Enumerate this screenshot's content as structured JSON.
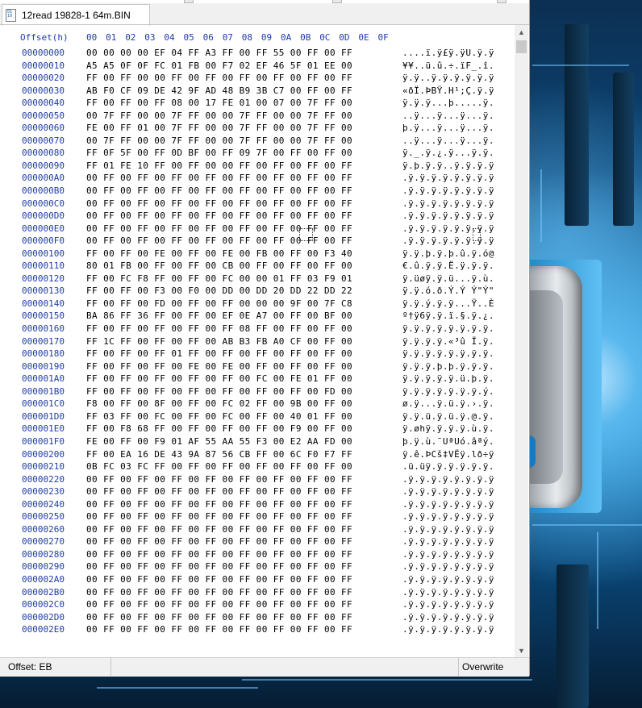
{
  "tab": {
    "title": "12read 19828-1 64m.BIN"
  },
  "header": {
    "offset_label": "Offset(h)",
    "columns": [
      "00",
      "01",
      "02",
      "03",
      "04",
      "05",
      "06",
      "07",
      "08",
      "09",
      "0A",
      "0B",
      "0C",
      "0D",
      "0E",
      "0F"
    ]
  },
  "rows": [
    {
      "offset": "00000000",
      "hex": "00 00 00 00 EF 04 FF A3 FF 00 FF 55 00 FF 00 FF",
      "ascii": "....ï.ÿ£ÿ.ÿU.ÿ.ÿ"
    },
    {
      "offset": "00000010",
      "hex": "A5 A5 0F 0F FC 01 FB 00 F7 02 EF 46 5F 01 EE 00",
      "ascii": "¥¥..ü.û.÷.ïF_.î."
    },
    {
      "offset": "00000020",
      "hex": "FF 00 FF 00 00 FF 00 FF 00 FF 00 FF 00 FF 00 FF",
      "ascii": "ÿ.ÿ..ÿ.ÿ.ÿ.ÿ.ÿ.ÿ"
    },
    {
      "offset": "00000030",
      "hex": "AB F0 CF 09 DE 42 9F AD 48 B9 3B C7 00 FF 00 FF",
      "ascii": "«ðÏ.ÞBŸ.H¹;Ç.ÿ.ÿ"
    },
    {
      "offset": "00000040",
      "hex": "FF 00 FF 00 FF 08 00 17 FE 01 00 07 00 7F FF 00",
      "ascii": "ÿ.ÿ.ÿ...þ.....ÿ."
    },
    {
      "offset": "00000050",
      "hex": "00 7F FF 00 00 7F FF 00 00 7F FF 00 00 7F FF 00",
      "ascii": "..ÿ...ÿ...ÿ...ÿ."
    },
    {
      "offset": "00000060",
      "hex": "FE 00 FF 01 00 7F FF 00 00 7F FF 00 00 7F FF 00",
      "ascii": "þ.ÿ...ÿ...ÿ...ÿ."
    },
    {
      "offset": "00000070",
      "hex": "00 7F FF 00 00 7F FF 00 00 7F FF 00 00 7F FF 00",
      "ascii": "..ÿ...ÿ...ÿ...ÿ."
    },
    {
      "offset": "00000080",
      "hex": "FF 0F 5F 00 FF 0D BF 00 FF 09 7F 00 FF 00 FF 00",
      "ascii": "ÿ._.ÿ.¿.ÿ...ÿ.ÿ."
    },
    {
      "offset": "00000090",
      "hex": "FF 01 FE 10 FF 00 FF 00 00 FF 00 FF 00 FF 00 FF",
      "ascii": "ÿ.þ.ÿ.ÿ..ÿ.ÿ.ÿ.ÿ"
    },
    {
      "offset": "000000A0",
      "hex": "00 FF 00 FF 00 FF 00 FF 00 FF 00 FF 00 FF 00 FF",
      "ascii": ".ÿ.ÿ.ÿ.ÿ.ÿ.ÿ.ÿ.ÿ"
    },
    {
      "offset": "000000B0",
      "hex": "00 FF 00 FF 00 FF 00 FF 00 FF 00 FF 00 FF 00 FF",
      "ascii": ".ÿ.ÿ.ÿ.ÿ.ÿ.ÿ.ÿ.ÿ"
    },
    {
      "offset": "000000C0",
      "hex": "00 FF 00 FF 00 FF 00 FF 00 FF 00 FF 00 FF 00 FF",
      "ascii": ".ÿ.ÿ.ÿ.ÿ.ÿ.ÿ.ÿ.ÿ"
    },
    {
      "offset": "000000D0",
      "hex": "00 FF 00 FF 00 FF 00 FF 00 FF 00 FF 00 FF 00 FF",
      "ascii": ".ÿ.ÿ.ÿ.ÿ.ÿ.ÿ.ÿ.ÿ"
    },
    {
      "offset": "000000E0",
      "hex": "00 FF 00 FF 00 FF 00 FF 00 FF 00 FF 00 FF 00 FF",
      "ascii": ".ÿ.ÿ.ÿ.ÿ.ÿ.ÿ.ÿ.ÿ"
    },
    {
      "offset": "000000F0",
      "hex": "00 FF 00 FF 00 FF 00 FF 00 FF 00 FF 00 FF 00 FF",
      "ascii": ".ÿ.ÿ.ÿ.ÿ.ÿ.ÿ.ÿ.ÿ"
    },
    {
      "offset": "00000100",
      "hex": "FF 00 FF 00 FE 00 FF 00 FE 00 FB 00 FF 00 F3 40",
      "ascii": "ÿ.ÿ.þ.ÿ.þ.û.ÿ.ó@"
    },
    {
      "offset": "00000110",
      "hex": "80 01 FB 00 FF 00 FF 00 CB 00 FF 00 FF 00 FF 00",
      "ascii": "€.û.ÿ.ÿ.Ë.ÿ.ÿ.ÿ."
    },
    {
      "offset": "00000120",
      "hex": "FF 00 FC F8 FF 00 FF 00 FC 00 00 01 FF 03 F9 01",
      "ascii": "ÿ.üøÿ.ÿ.ü...ÿ.ù."
    },
    {
      "offset": "00000130",
      "hex": "FF 00 FF 00 F3 00 F0 00 DD 00 DD 20 DD 22 DD 22",
      "ascii": "ÿ.ÿ.ó.ð.Ý.Ý Ý\"Ý\""
    },
    {
      "offset": "00000140",
      "hex": "FF 00 FF 00 FD 00 FF 00 FF 00 00 00 9F 00 7F C8",
      "ascii": "ÿ.ÿ.ý.ÿ.ÿ...Ÿ..È"
    },
    {
      "offset": "00000150",
      "hex": "BA 86 FF 36 FF 00 FF 00 EF 0E A7 00 FF 00 BF 00",
      "ascii": "º†ÿ6ÿ.ÿ.ï.§.ÿ.¿."
    },
    {
      "offset": "00000160",
      "hex": "FF 00 FF 00 FF 00 FF 00 FF 08 FF 00 FF 00 FF 00",
      "ascii": "ÿ.ÿ.ÿ.ÿ.ÿ.ÿ.ÿ.ÿ."
    },
    {
      "offset": "00000170",
      "hex": "FF 1C FF 00 FF 00 FF 00 AB B3 FB A0 CF 00 FF 00",
      "ascii": "ÿ.ÿ.ÿ.ÿ.«³û Ï.ÿ."
    },
    {
      "offset": "00000180",
      "hex": "FF 00 FF 00 FF 01 FF 00 FF 00 FF 00 FF 00 FF 00",
      "ascii": "ÿ.ÿ.ÿ.ÿ.ÿ.ÿ.ÿ.ÿ."
    },
    {
      "offset": "00000190",
      "hex": "FF 00 FF 00 FF 00 FE 00 FE 00 FF 00 FF 00 FF 00",
      "ascii": "ÿ.ÿ.ÿ.þ.þ.ÿ.ÿ.ÿ."
    },
    {
      "offset": "000001A0",
      "hex": "FF 00 FF 00 FF 00 FF 00 FF 00 FC 00 FE 01 FF 00",
      "ascii": "ÿ.ÿ.ÿ.ÿ.ÿ.ü.þ.ÿ."
    },
    {
      "offset": "000001B0",
      "hex": "FF 00 FF 00 FF 00 FF 00 FF 00 FF 00 FF 00 FD 00",
      "ascii": "ÿ.ÿ.ÿ.ÿ.ÿ.ÿ.ÿ.ý."
    },
    {
      "offset": "000001C0",
      "hex": "F8 00 FF 00 8F 00 FF 00 FC 02 FF 00 9B 00 FF 00",
      "ascii": "ø.ÿ...ÿ.ü.ÿ.›.ÿ."
    },
    {
      "offset": "000001D0",
      "hex": "FF 03 FF 00 FC 00 FF 00 FC 00 FF 00 40 01 FF 00",
      "ascii": "ÿ.ÿ.ü.ÿ.ü.ÿ.@.ÿ."
    },
    {
      "offset": "000001E0",
      "hex": "FF 00 F8 68 FF 00 FF 00 FF 00 FF 00 F9 00 FF 00",
      "ascii": "ÿ.øhÿ.ÿ.ÿ.ÿ.ù.ÿ."
    },
    {
      "offset": "000001F0",
      "hex": "FE 00 FF 00 F9 01 AF 55 AA 55 F3 00 E2 AA FD 00",
      "ascii": "þ.ÿ.ù.¯UªUó.âªý."
    },
    {
      "offset": "00000200",
      "hex": "FF 00 EA 16 DE 43 9A 87 56 CB FF 00 6C F0 F7 FF",
      "ascii": "ÿ.ê.ÞCš‡VËÿ.lð÷ÿ"
    },
    {
      "offset": "00000210",
      "hex": "0B FC 03 FC FF 00 FF 00 FF 00 FF 00 FF 00 FF 00",
      "ascii": ".ü.üÿ.ÿ.ÿ.ÿ.ÿ.ÿ."
    },
    {
      "offset": "00000220",
      "hex": "00 FF 00 FF 00 FF 00 FF 00 FF 00 FF 00 FF 00 FF",
      "ascii": ".ÿ.ÿ.ÿ.ÿ.ÿ.ÿ.ÿ.ÿ"
    },
    {
      "offset": "00000230",
      "hex": "00 FF 00 FF 00 FF 00 FF 00 FF 00 FF 00 FF 00 FF",
      "ascii": ".ÿ.ÿ.ÿ.ÿ.ÿ.ÿ.ÿ.ÿ"
    },
    {
      "offset": "00000240",
      "hex": "00 FF 00 FF 00 FF 00 FF 00 FF 00 FF 00 FF 00 FF",
      "ascii": ".ÿ.ÿ.ÿ.ÿ.ÿ.ÿ.ÿ.ÿ"
    },
    {
      "offset": "00000250",
      "hex": "00 FF 00 FF 00 FF 00 FF 00 FF 00 FF 00 FF 00 FF",
      "ascii": ".ÿ.ÿ.ÿ.ÿ.ÿ.ÿ.ÿ.ÿ"
    },
    {
      "offset": "00000260",
      "hex": "00 FF 00 FF 00 FF 00 FF 00 FF 00 FF 00 FF 00 FF",
      "ascii": ".ÿ.ÿ.ÿ.ÿ.ÿ.ÿ.ÿ.ÿ"
    },
    {
      "offset": "00000270",
      "hex": "00 FF 00 FF 00 FF 00 FF 00 FF 00 FF 00 FF 00 FF",
      "ascii": ".ÿ.ÿ.ÿ.ÿ.ÿ.ÿ.ÿ.ÿ"
    },
    {
      "offset": "00000280",
      "hex": "00 FF 00 FF 00 FF 00 FF 00 FF 00 FF 00 FF 00 FF",
      "ascii": ".ÿ.ÿ.ÿ.ÿ.ÿ.ÿ.ÿ.ÿ"
    },
    {
      "offset": "00000290",
      "hex": "00 FF 00 FF 00 FF 00 FF 00 FF 00 FF 00 FF 00 FF",
      "ascii": ".ÿ.ÿ.ÿ.ÿ.ÿ.ÿ.ÿ.ÿ"
    },
    {
      "offset": "000002A0",
      "hex": "00 FF 00 FF 00 FF 00 FF 00 FF 00 FF 00 FF 00 FF",
      "ascii": ".ÿ.ÿ.ÿ.ÿ.ÿ.ÿ.ÿ.ÿ"
    },
    {
      "offset": "000002B0",
      "hex": "00 FF 00 FF 00 FF 00 FF 00 FF 00 FF 00 FF 00 FF",
      "ascii": ".ÿ.ÿ.ÿ.ÿ.ÿ.ÿ.ÿ.ÿ"
    },
    {
      "offset": "000002C0",
      "hex": "00 FF 00 FF 00 FF 00 FF 00 FF 00 FF 00 FF 00 FF",
      "ascii": ".ÿ.ÿ.ÿ.ÿ.ÿ.ÿ.ÿ.ÿ"
    },
    {
      "offset": "000002D0",
      "hex": "00 FF 00 FF 00 FF 00 FF 00 FF 00 FF 00 FF 00 FF",
      "ascii": ".ÿ.ÿ.ÿ.ÿ.ÿ.ÿ.ÿ.ÿ"
    },
    {
      "offset": "000002E0",
      "hex": "00 FF 00 FF 00 FF 00 FF 00 FF 00 FF 00 FF 00 FF",
      "ascii": ".ÿ.ÿ.ÿ.ÿ.ÿ.ÿ.ÿ.ÿ"
    }
  ],
  "status": {
    "offset": "Offset: EB",
    "mode": "Overwrite"
  },
  "icons": {
    "file": "file-icon",
    "scroll_up": "scroll-up-icon",
    "scroll_down": "scroll-down-icon"
  },
  "colors": {
    "offset_text": "#1f3ba8",
    "background": "#ffffff",
    "chrome": "#f0f0f0"
  }
}
